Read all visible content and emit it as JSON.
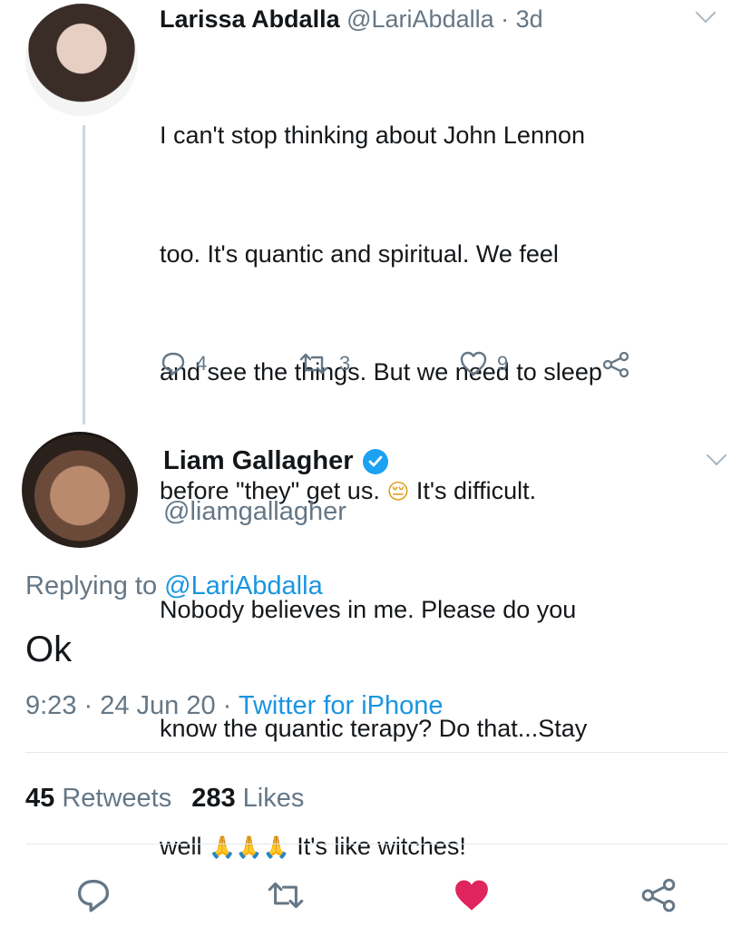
{
  "tweet": {
    "author_name": "Larissa Abdalla",
    "author_handle": "@LariAbdalla",
    "separator": "·",
    "time": "3d",
    "body_lines": [
      "I can't stop thinking about John Lennon",
      "too. It's quantic and spiritual. We feel",
      "and see the things. But we need to sleep",
      "before \"they\" get us.",
      "It's difficult.",
      "Nobody believes in me. Please do you",
      "know the quantic terapy? Do that...Stay",
      "well",
      "It's like witches!"
    ],
    "emoji_relieved": "😔",
    "emoji_pray": "🙏🙏🙏",
    "replies": "4",
    "retweets": "3",
    "likes": "9"
  },
  "reply": {
    "author_name": "Liam Gallagher",
    "author_handle": "@liamgallagher",
    "replying_prefix": "Replying to",
    "replying_handle": "@LariAbdalla",
    "text": "Ok",
    "timestamp": "9:23 · 24 Jun 20 ·",
    "source": "Twitter for iPhone",
    "retweets_count": "45",
    "retweets_label": "Retweets",
    "likes_count": "283",
    "likes_label": "Likes"
  },
  "icons": {
    "reply": "reply-icon",
    "retweet": "retweet-icon",
    "like": "heart-icon",
    "share": "share-icon",
    "verified": "verified-badge-icon",
    "chevron": "chevron-down-icon"
  },
  "colors": {
    "link": "#1b95e0",
    "muted": "#657786",
    "like_active": "#e0245e",
    "verified": "#1da1f2"
  }
}
